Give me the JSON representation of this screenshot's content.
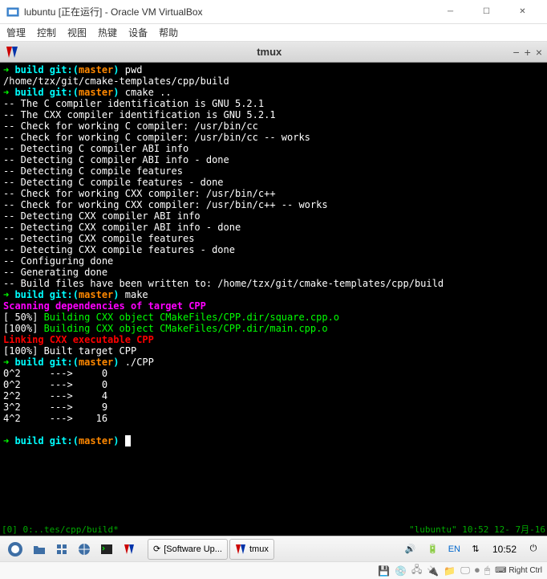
{
  "vbox": {
    "title": "lubuntu [正在运行] - Oracle VM VirtualBox",
    "menu": [
      "管理",
      "控制",
      "视图",
      "热键",
      "设备",
      "帮助"
    ],
    "host_key": "Right Ctrl"
  },
  "tmux_window": {
    "title": "tmux"
  },
  "prompts": {
    "p1": {
      "arrow": "➜ ",
      "dir": "build",
      "git": " git:(",
      "branch": "master",
      "close": ")",
      "cmd": " pwd"
    },
    "p2": {
      "arrow": "➜ ",
      "dir": "build",
      "git": " git:(",
      "branch": "master",
      "close": ")",
      "cmd": " cmake .."
    },
    "p3": {
      "arrow": "➜ ",
      "dir": "build",
      "git": " git:(",
      "branch": "master",
      "close": ")",
      "cmd": " make"
    },
    "p4": {
      "arrow": "➜ ",
      "dir": "build",
      "git": " git:(",
      "branch": "master",
      "close": ")",
      "cmd": " ./CPP"
    },
    "p5": {
      "arrow": "➜ ",
      "dir": "build",
      "git": " git:(",
      "branch": "master",
      "close": ") "
    }
  },
  "term": {
    "pwd_out": "/home/tzx/git/cmake-templates/cpp/build",
    "cmake": [
      "-- The C compiler identification is GNU 5.2.1",
      "-- The CXX compiler identification is GNU 5.2.1",
      "-- Check for working C compiler: /usr/bin/cc",
      "-- Check for working C compiler: /usr/bin/cc -- works",
      "-- Detecting C compiler ABI info",
      "-- Detecting C compiler ABI info - done",
      "-- Detecting C compile features",
      "-- Detecting C compile features - done",
      "-- Check for working CXX compiler: /usr/bin/c++",
      "-- Check for working CXX compiler: /usr/bin/c++ -- works",
      "-- Detecting CXX compiler ABI info",
      "-- Detecting CXX compiler ABI info - done",
      "-- Detecting CXX compile features",
      "-- Detecting CXX compile features - done",
      "-- Configuring done",
      "-- Generating done",
      "-- Build files have been written to: /home/tzx/git/cmake-templates/cpp/build"
    ],
    "scan": "Scanning dependencies of target CPP",
    "build1_pct": "[ 50%] ",
    "build1_txt": "Building CXX object CMakeFiles/CPP.dir/square.cpp.o",
    "build2_pct": "[100%] ",
    "build2_txt": "Building CXX object CMakeFiles/CPP.dir/main.cpp.o",
    "link": "Linking CXX executable CPP",
    "built": "[100%] Built target CPP",
    "output": [
      "0^2     --->     0",
      "0^2     --->     0",
      "2^2     --->     4",
      "3^2     --->     9",
      "4^2     --->    16"
    ]
  },
  "tmux_status": {
    "left": "[0] 0:..tes/cpp/build*",
    "right": "\"lubuntu\" 10:52 12- 7月-16"
  },
  "taskbar": {
    "task1": "[Software Up...",
    "task2": "tmux",
    "lang": "EN",
    "clock": "10:52"
  }
}
